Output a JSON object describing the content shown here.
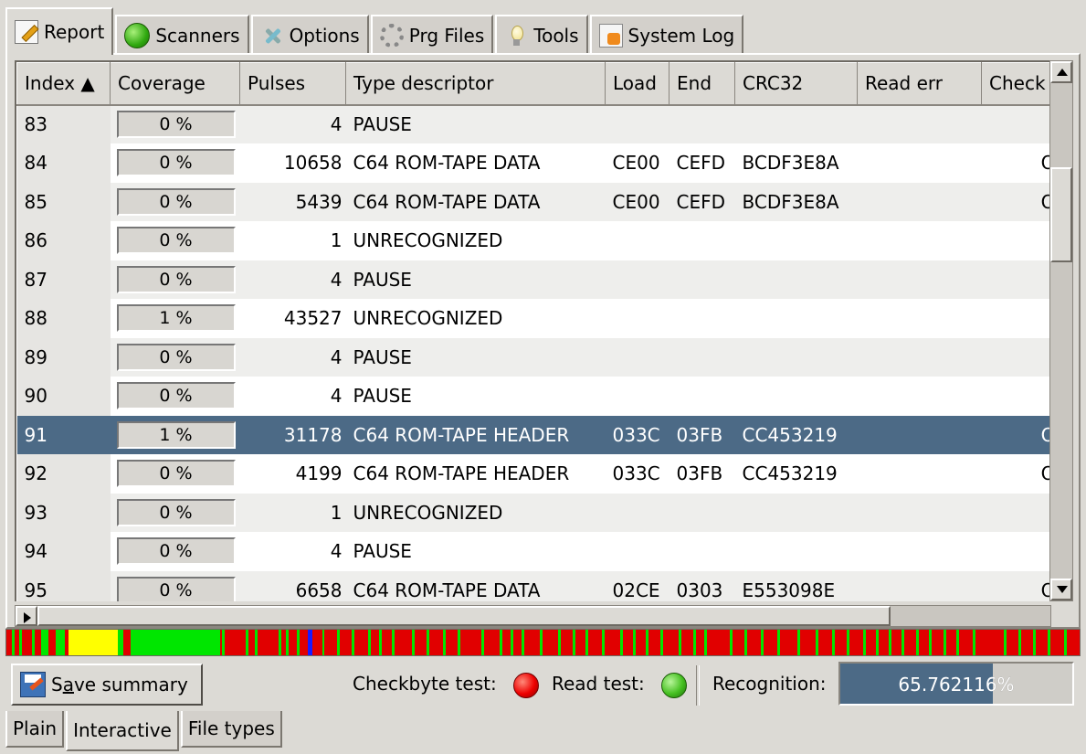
{
  "top_tabs": [
    {
      "label": "Report",
      "icon": "report-icon",
      "active": true
    },
    {
      "label": "Scanners",
      "icon": "scanner-icon"
    },
    {
      "label": "Options",
      "icon": "options-icon"
    },
    {
      "label": "Prg Files",
      "icon": "prg-files-icon"
    },
    {
      "label": "Tools",
      "icon": "tools-icon"
    },
    {
      "label": "System Log",
      "icon": "system-log-icon"
    }
  ],
  "table": {
    "columns": [
      "Index ▲",
      "Coverage",
      "Pulses",
      "Type descriptor",
      "Load",
      "End",
      "CRC32",
      "Read err",
      "Check"
    ],
    "rows": [
      {
        "index": "83",
        "coverage": "0 %",
        "pulses": "4",
        "type": "PAUSE",
        "load": "",
        "end": "",
        "crc": "",
        "read_err": "",
        "check": ""
      },
      {
        "index": "84",
        "coverage": "0 %",
        "pulses": "10658",
        "type": "C64 ROM-TAPE DATA",
        "load": "CE00",
        "end": "CEFD",
        "crc": "BCDF3E8A",
        "read_err": "",
        "check": "OK"
      },
      {
        "index": "85",
        "coverage": "0 %",
        "pulses": "5439",
        "type": "C64 ROM-TAPE DATA",
        "load": "CE00",
        "end": "CEFD",
        "crc": "BCDF3E8A",
        "read_err": "",
        "check": "OK"
      },
      {
        "index": "86",
        "coverage": "0 %",
        "pulses": "1",
        "type": "UNRECOGNIZED",
        "load": "",
        "end": "",
        "crc": "",
        "read_err": "",
        "check": ""
      },
      {
        "index": "87",
        "coverage": "0 %",
        "pulses": "4",
        "type": "PAUSE",
        "load": "",
        "end": "",
        "crc": "",
        "read_err": "",
        "check": ""
      },
      {
        "index": "88",
        "coverage": "1 %",
        "pulses": "43527",
        "type": "UNRECOGNIZED",
        "load": "",
        "end": "",
        "crc": "",
        "read_err": "",
        "check": ""
      },
      {
        "index": "89",
        "coverage": "0 %",
        "pulses": "4",
        "type": "PAUSE",
        "load": "",
        "end": "",
        "crc": "",
        "read_err": "",
        "check": ""
      },
      {
        "index": "90",
        "coverage": "0 %",
        "pulses": "4",
        "type": "PAUSE",
        "load": "",
        "end": "",
        "crc": "",
        "read_err": "",
        "check": ""
      },
      {
        "index": "91",
        "coverage": "1 %",
        "pulses": "31178",
        "type": "C64 ROM-TAPE HEADER",
        "load": "033C",
        "end": "03FB",
        "crc": "CC453219",
        "read_err": "",
        "check": "OK",
        "selected": true
      },
      {
        "index": "92",
        "coverage": "0 %",
        "pulses": "4199",
        "type": "C64 ROM-TAPE HEADER",
        "load": "033C",
        "end": "03FB",
        "crc": "CC453219",
        "read_err": "",
        "check": "OK"
      },
      {
        "index": "93",
        "coverage": "0 %",
        "pulses": "1",
        "type": "UNRECOGNIZED",
        "load": "",
        "end": "",
        "crc": "",
        "read_err": "",
        "check": ""
      },
      {
        "index": "94",
        "coverage": "0 %",
        "pulses": "4",
        "type": "PAUSE",
        "load": "",
        "end": "",
        "crc": "",
        "read_err": "",
        "check": ""
      },
      {
        "index": "95",
        "coverage": "0 %",
        "pulses": "6658",
        "type": "C64 ROM-TAPE DATA",
        "load": "02CE",
        "end": "0303",
        "crc": "E553098E",
        "read_err": "",
        "check": "OK"
      }
    ]
  },
  "strip_colors": {
    "red": "#e10000",
    "green": "#00e600",
    "yellow": "#ffff00",
    "blue": "#1a1aff"
  },
  "status": {
    "save_label_pre": "S",
    "save_label_ul": "a",
    "save_label_post": "ve summary",
    "checkbyte_label": "Checkbyte test:",
    "checkbyte_state": "fail",
    "read_label": "Read test:",
    "read_state": "pass",
    "recognition_label": "Recognition:",
    "recognition_value": "65.762116%",
    "recognition_fraction": 0.6576
  },
  "bottom_tabs": [
    {
      "label": "Plain"
    },
    {
      "label": "Interactive",
      "active": true
    },
    {
      "label": "File types"
    }
  ]
}
